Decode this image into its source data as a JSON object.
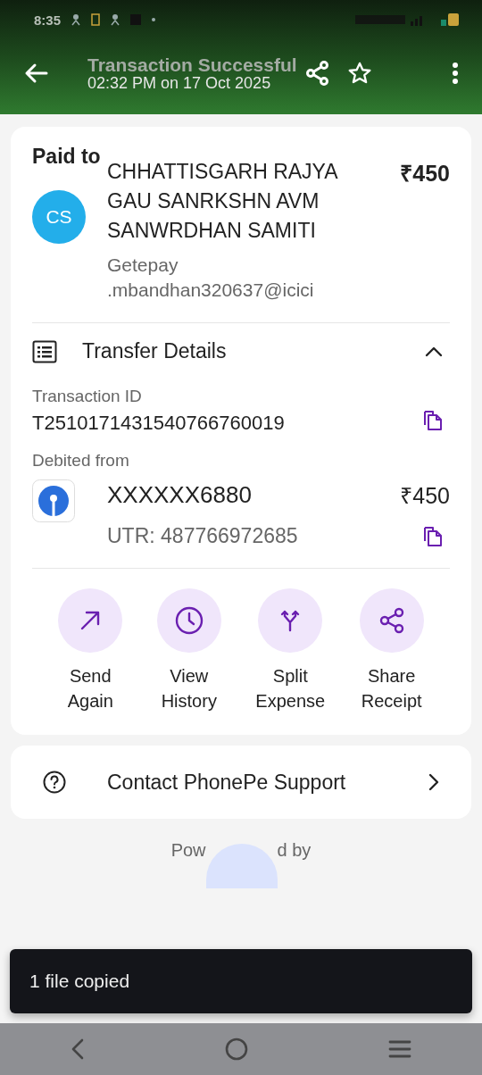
{
  "status_bar": {
    "time": "8:35"
  },
  "header": {
    "title": "Transaction Successful",
    "subtitle": "02:32 PM on 17 Oct 2025"
  },
  "payment": {
    "label": "Paid to",
    "initials": "CS",
    "payee": "CHHATTISGARH RAJYA GAU SANRKSHN AVM SANWRDHAN SAMITI",
    "amount": "₹450",
    "upi_id": [
      "Getepay",
      ".mbandhan320637@icici"
    ]
  },
  "transfer_details": {
    "title": "Transfer Details",
    "expanded": true,
    "transaction_id_label": "Transaction ID",
    "transaction_id": "T2510171431540766760019",
    "debited_label": "Debited from",
    "account": "XXXXXX6880",
    "debited_amount": "₹450",
    "utr": "UTR: 487766972685"
  },
  "actions": [
    {
      "kind": "send",
      "label": [
        "Send",
        "Again"
      ]
    },
    {
      "kind": "history",
      "label": [
        "View",
        "History"
      ]
    },
    {
      "kind": "split",
      "label": [
        "Split",
        "Expense"
      ]
    },
    {
      "kind": "share",
      "label": [
        "Share",
        "Receipt"
      ]
    }
  ],
  "support": {
    "label": "Contact PhonePe Support"
  },
  "powered_by": [
    "Pow",
    "d by"
  ],
  "toast": {
    "message": "1 file copied"
  }
}
